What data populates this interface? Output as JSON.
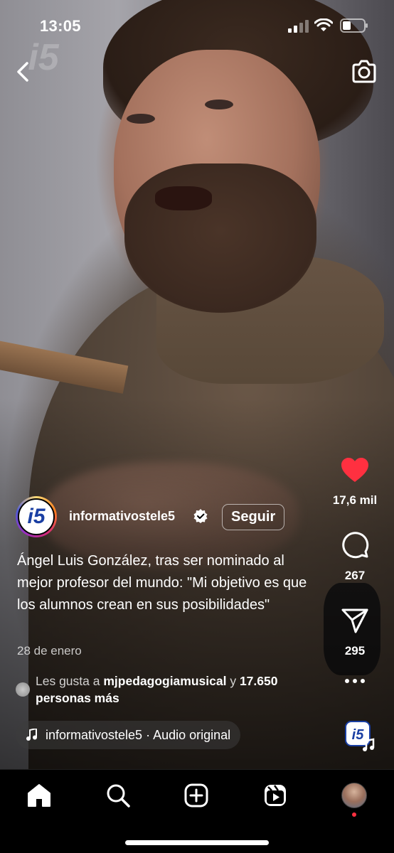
{
  "status_bar": {
    "time": "13:05"
  },
  "reel": {
    "watermark": "i5",
    "author": {
      "username": "informativostele5",
      "avatar_text": "i5",
      "follow_label": "Seguir"
    },
    "caption": "Ángel Luis González, tras ser nominado al mejor profesor del mundo: \"Mi objetivo es que los alumnos crean en sus posibilidades\"",
    "date": "28 de enero",
    "likes": {
      "prefix": "Les gusta a ",
      "user": "mjpedagogiamusical",
      "middle": " y ",
      "others": "17.650 personas más"
    },
    "audio": {
      "label": "informativostele5 · Audio original"
    }
  },
  "actions": {
    "like_count": "17,6 mil",
    "comment_count": "267",
    "share_count": "295"
  },
  "icons": {
    "back": "back-chevron-icon",
    "camera": "camera-icon",
    "like": "heart-icon",
    "comment": "comment-icon",
    "share": "send-icon",
    "more": "more-icon",
    "home": "home-icon",
    "search": "search-icon",
    "create": "create-icon",
    "reels": "reels-icon"
  },
  "colors": {
    "like": "#ff3040",
    "background": "#000000",
    "brand_blue": "#1a3fa3"
  }
}
